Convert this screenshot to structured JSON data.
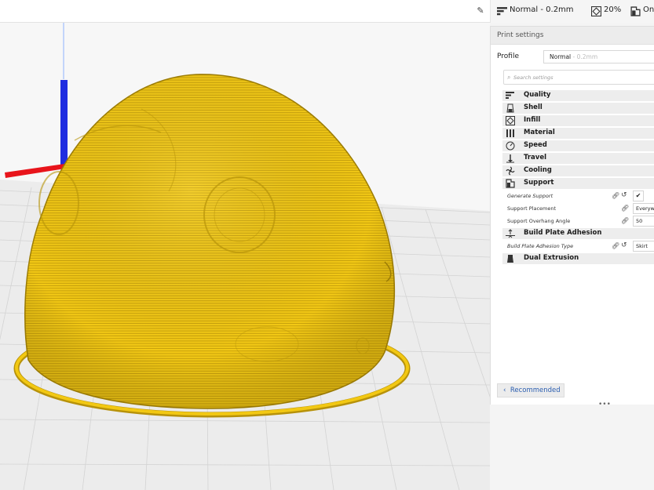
{
  "toolbar": {
    "edit_icon": "pencil-icon",
    "profile_summary": "Normal - 0.2mm",
    "infill_summary": "20%",
    "support_summary": "On"
  },
  "panel": {
    "title": "Print settings",
    "profile_label": "Profile",
    "profile_name": "Normal",
    "profile_layer": " - 0.2mm",
    "search_placeholder": "Search settings",
    "categories": [
      {
        "label": "Quality",
        "icon": "quality-icon"
      },
      {
        "label": "Shell",
        "icon": "shell-icon"
      },
      {
        "label": "Infill",
        "icon": "infill-icon"
      },
      {
        "label": "Material",
        "icon": "material-icon"
      },
      {
        "label": "Speed",
        "icon": "speed-icon"
      },
      {
        "label": "Travel",
        "icon": "travel-icon"
      },
      {
        "label": "Cooling",
        "icon": "cooling-icon"
      },
      {
        "label": "Support",
        "icon": "support-icon"
      }
    ],
    "support_settings": [
      {
        "label": "Generate Support",
        "value": "✔"
      },
      {
        "label": "Support Placement",
        "value": "Everywhere"
      },
      {
        "label": "Support Overhang Angle",
        "value": "50"
      }
    ],
    "adhesion_category": "Build Plate Adhesion",
    "adhesion_setting": {
      "label": "Build Plate Adhesion Type",
      "value": "Skirt"
    },
    "dual_category": "Dual Extrusion",
    "recommended_label": "Recommended"
  },
  "colors": {
    "model": "#f2c813",
    "model_dark": "#b8940a",
    "axis_x": "#e8141b",
    "axis_y": "#1f2de0",
    "grid_line": "#d2d2d2",
    "accent": "#2a5db0"
  }
}
